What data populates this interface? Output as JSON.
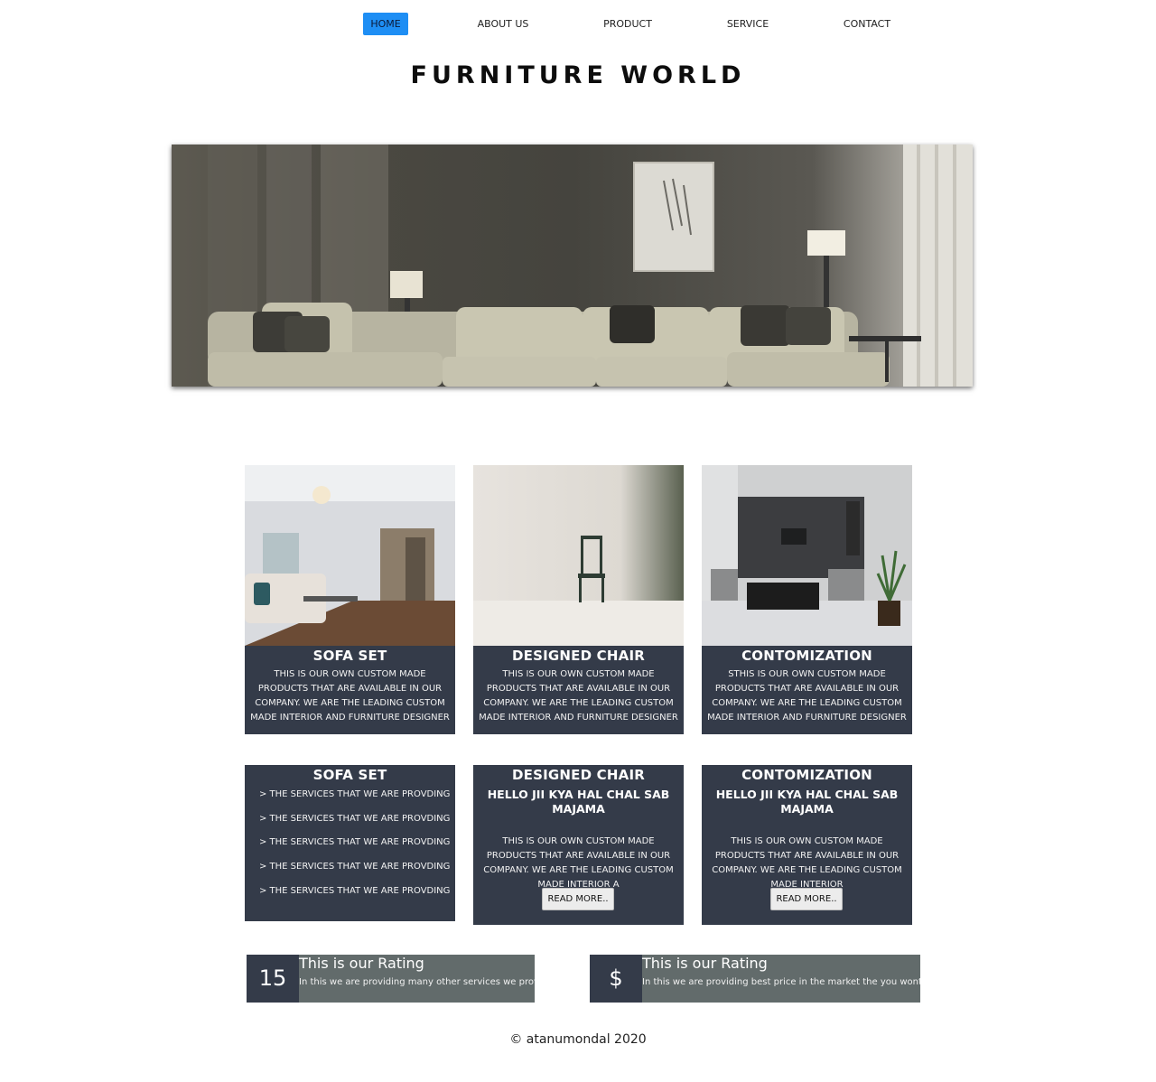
{
  "nav": {
    "items": [
      {
        "label": "HOME"
      },
      {
        "label": "ABOUT US"
      },
      {
        "label": "PRODUCT"
      },
      {
        "label": "SERVICE"
      },
      {
        "label": "CONTACT"
      }
    ],
    "active_color": "#1e8ef4"
  },
  "header": {
    "title": "FURNITURE WORLD"
  },
  "hero": {
    "image": "living-room-sofa-photo"
  },
  "product_cards": [
    {
      "title": "SOFA SET",
      "image": "sofa-set-room-photo",
      "description": "THIS IS OUR OWN CUSTOM MADE PRODUCTS THAT ARE AVAILABLE IN OUR COMPANY. WE ARE THE LEADING CUSTOM MADE INTERIOR AND FURNITURE DESIGNER"
    },
    {
      "title": "DESIGNED CHAIR",
      "image": "designed-chair-photo",
      "description": "THIS IS OUR OWN CUSTOM MADE PRODUCTS THAT ARE AVAILABLE IN OUR COMPANY. WE ARE THE LEADING CUSTOM MADE INTERIOR AND FURNITURE DESIGNER"
    },
    {
      "title": "CONTOMIZATION",
      "image": "modern-interior-photo",
      "description": "STHIS IS OUR OWN CUSTOM MADE PRODUCTS THAT ARE AVAILABLE IN OUR COMPANY. WE ARE THE LEADING CUSTOM MADE INTERIOR AND FURNITURE DESIGNER"
    }
  ],
  "service_cards": {
    "sofa": {
      "title": "SOFA SET",
      "items": [
        "> THE SERVICES THAT WE ARE PROVDING",
        "> THE SERVICES THAT WE ARE PROVDING",
        "> THE SERVICES THAT WE ARE PROVDING",
        "> THE SERVICES THAT WE ARE PROVDING",
        "> THE SERVICES THAT WE ARE PROVDING"
      ]
    },
    "chair": {
      "title": "DESIGNED CHAIR",
      "subtitle": "HELLO JII KYA HAL CHAL SAB MAJAMA",
      "description": "THIS IS OUR OWN CUSTOM MADE PRODUCTS THAT ARE AVAILABLE IN OUR COMPANY. WE ARE THE LEADING CUSTOM MADE INTERIOR A",
      "button": "READ MORE.."
    },
    "custom": {
      "title": "CONTOMIZATION",
      "subtitle": "HELLO JII KYA HAL CHAL SAB MAJAMA",
      "description": "THIS IS OUR OWN CUSTOM MADE PRODUCTS THAT ARE AVAILABLE IN OUR COMPANY. WE ARE THE LEADING CUSTOM MADE INTERIOR",
      "button": "READ MORE.."
    }
  },
  "ratings": [
    {
      "badge": "15",
      "title": "This is our Rating",
      "description": "In this we are providing many other services we provide"
    },
    {
      "badge": "$",
      "title": "This is our Rating",
      "description": "In this we are providing best price in the market the you wont get"
    }
  ],
  "footer": {
    "text": "© atanumondal 2020"
  },
  "colors": {
    "card_bg": "#343b49",
    "rating_bg": "#626b6b",
    "accent": "#1e8ef4"
  }
}
